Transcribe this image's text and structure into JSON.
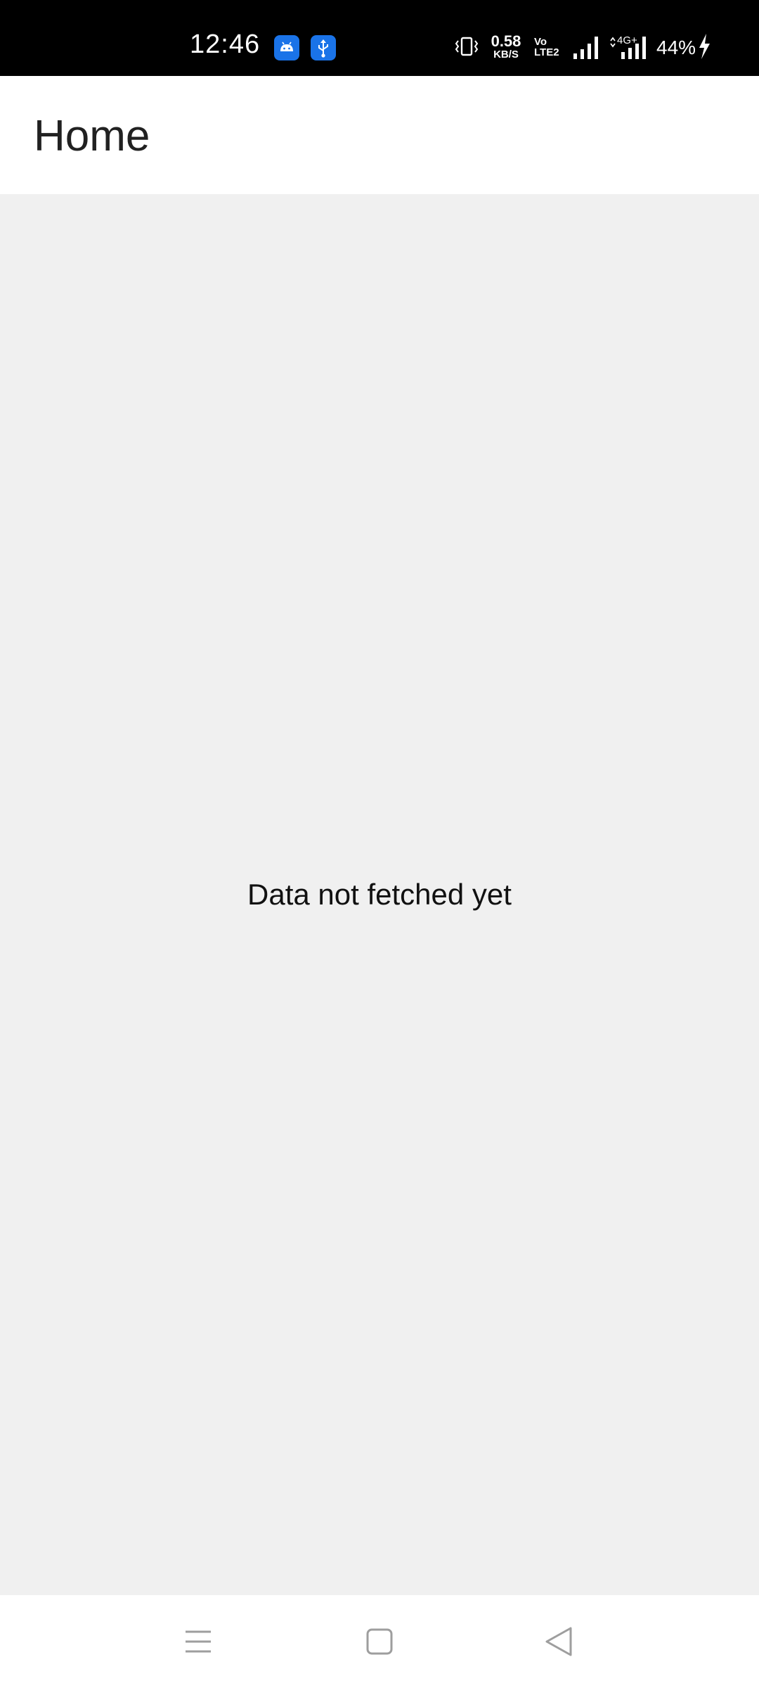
{
  "status_bar": {
    "time": "12:46",
    "notification_icons": [
      "android-icon",
      "usb-icon"
    ],
    "net_speed_value": "0.58",
    "net_speed_unit": "KB/S",
    "volte_top": "Vo",
    "volte_bottom": "LTE2",
    "network_type": "4G+",
    "battery_percent": "44%",
    "charging": true
  },
  "app_bar": {
    "title": "Home"
  },
  "content": {
    "empty_message": "Data not fetched yet"
  },
  "nav_bar": {
    "buttons": [
      "menu-icon",
      "home-icon",
      "back-icon"
    ]
  },
  "colors": {
    "status_bar_bg": "#000000",
    "app_bar_bg": "#ffffff",
    "content_bg": "#f0f0f0",
    "notification_icon_bg": "#1a73e8",
    "nav_icon": "#9e9e9e"
  }
}
